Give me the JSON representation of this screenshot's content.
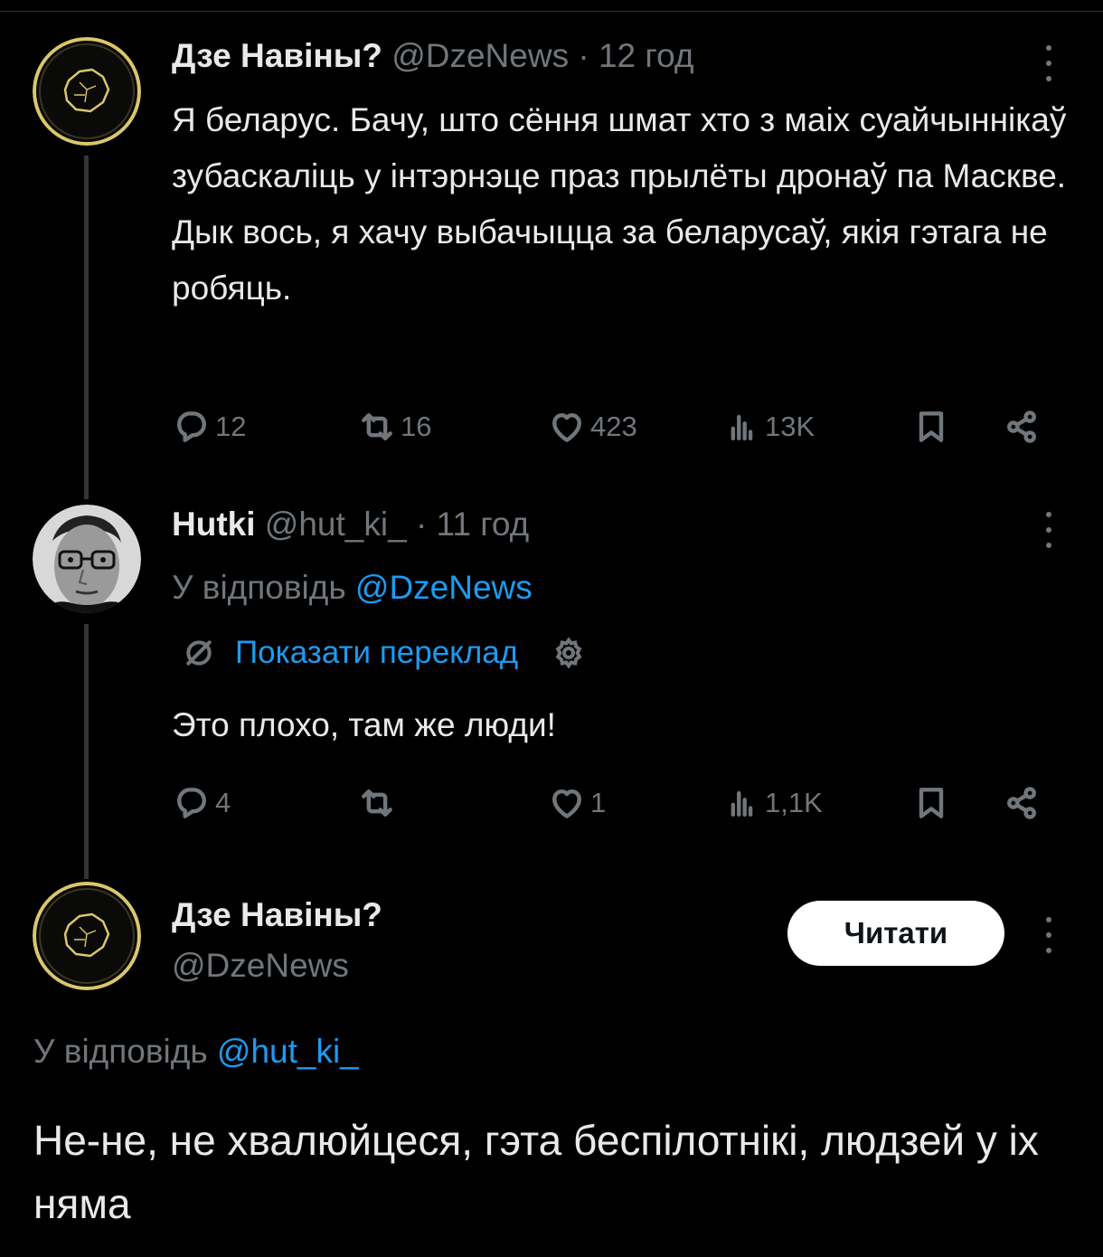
{
  "tweet1": {
    "name": "Дзе Навіны?",
    "handle": "@DzeNews",
    "time": "12 год",
    "text": "Я беларус. Бачу, што сёння шмат хто з маіх суайчыннікаў зубаскаліць у інтэрнэце праз прылёты дронаў па Маскве. Дык вось, я хачу выбачыцца за беларусаў, якія гэтага не робяць.",
    "replies": "12",
    "retweets": "16",
    "likes": "423",
    "views": "13K"
  },
  "tweet2": {
    "name": "Hutki",
    "handle": "@hut_ki_",
    "time": "11 год",
    "reply_prefix": "У відповідь",
    "reply_to": "@DzeNews",
    "translate_label": "Показати переклад",
    "text": "Это плохо, там же люди!",
    "replies": "4",
    "retweets": "",
    "likes": "1",
    "views": "1,1K"
  },
  "tweet3": {
    "name": "Дзе Навіны?",
    "handle": "@DzeNews",
    "follow_label": "Читати",
    "reply_prefix": "У відповідь",
    "reply_to": "@hut_ki_",
    "text": "Не-не, не хвалюйцеся, гэта беспілотнікі, людзей у іх няма"
  },
  "separator": "·",
  "colors": {
    "background": "#000000",
    "text": "#e7e9ea",
    "secondary": "#71767b",
    "link": "#1d9bf0",
    "logo_gold": "#d9c76a"
  }
}
